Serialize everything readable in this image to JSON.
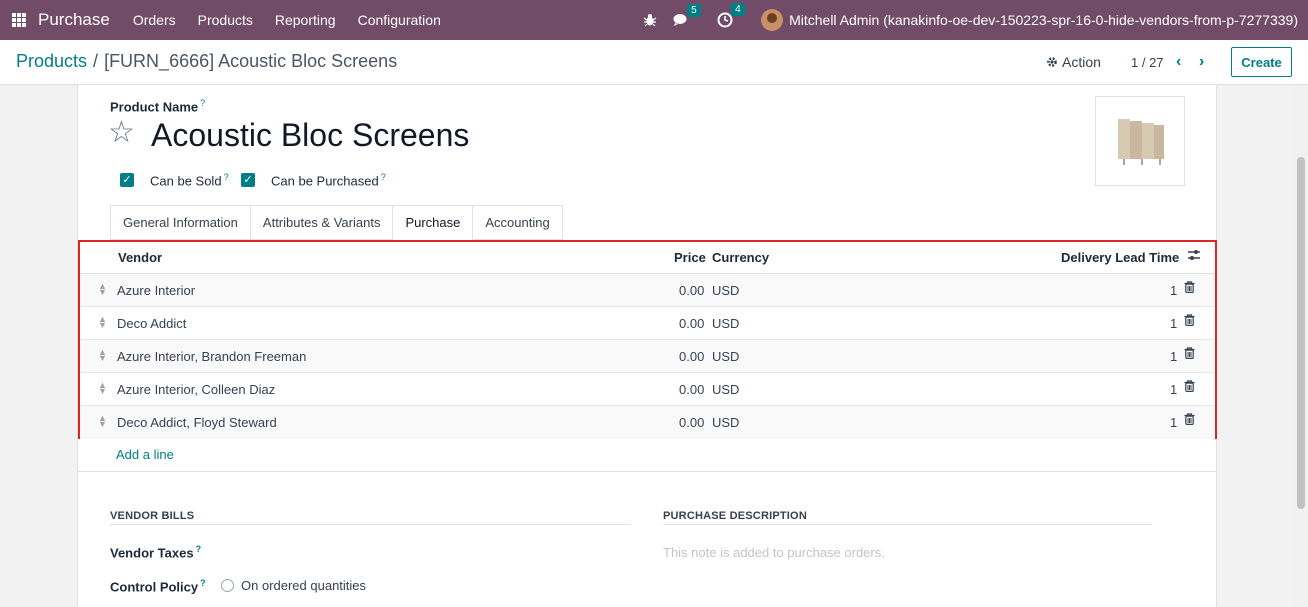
{
  "navbar": {
    "app_name": "Purchase",
    "menus": [
      "Orders",
      "Products",
      "Reporting",
      "Configuration"
    ],
    "messages_count": "5",
    "activities_count": "4",
    "user": "Mitchell Admin (kanakinfo-oe-dev-150223-spr-16-0-hide-vendors-from-p-7277339)",
    "color": "#714b67"
  },
  "control_panel": {
    "breadcrumb_root": "Products",
    "breadcrumb_sep": "/",
    "breadcrumb_current": "[FURN_6666] Acoustic Bloc Screens",
    "action_label": "Action",
    "pager": "1 / 27",
    "create_label": "Create"
  },
  "form": {
    "product_name_label": "Product Name",
    "help": "?",
    "product_name": "Acoustic Bloc Screens",
    "can_be_sold_label": "Can be Sold",
    "can_be_purchased_label": "Can be Purchased",
    "tabs": [
      "General Information",
      "Attributes & Variants",
      "Purchase",
      "Accounting"
    ],
    "active_tab": "Purchase"
  },
  "vendor_table": {
    "headers": {
      "vendor": "Vendor",
      "price": "Price",
      "currency": "Currency",
      "lead": "Delivery Lead Time"
    },
    "rows": [
      {
        "vendor": "Azure Interior",
        "price": "0.00",
        "currency": "USD",
        "lead": "1"
      },
      {
        "vendor": "Deco Addict",
        "price": "0.00",
        "currency": "USD",
        "lead": "1"
      },
      {
        "vendor": "Azure Interior, Brandon Freeman",
        "price": "0.00",
        "currency": "USD",
        "lead": "1"
      },
      {
        "vendor": "Azure Interior, Colleen Diaz",
        "price": "0.00",
        "currency": "USD",
        "lead": "1"
      },
      {
        "vendor": "Deco Addict, Floyd Steward",
        "price": "0.00",
        "currency": "USD",
        "lead": "1"
      }
    ],
    "add_line": "Add a line",
    "highlight_color": "#dc2626"
  },
  "vendor_bills": {
    "title": "VENDOR BILLS",
    "vendor_taxes_label": "Vendor Taxes",
    "control_policy_label": "Control Policy",
    "control_policy_option": "On ordered quantities"
  },
  "purchase_description": {
    "title": "PURCHASE DESCRIPTION",
    "placeholder": "This note is added to purchase orders."
  }
}
